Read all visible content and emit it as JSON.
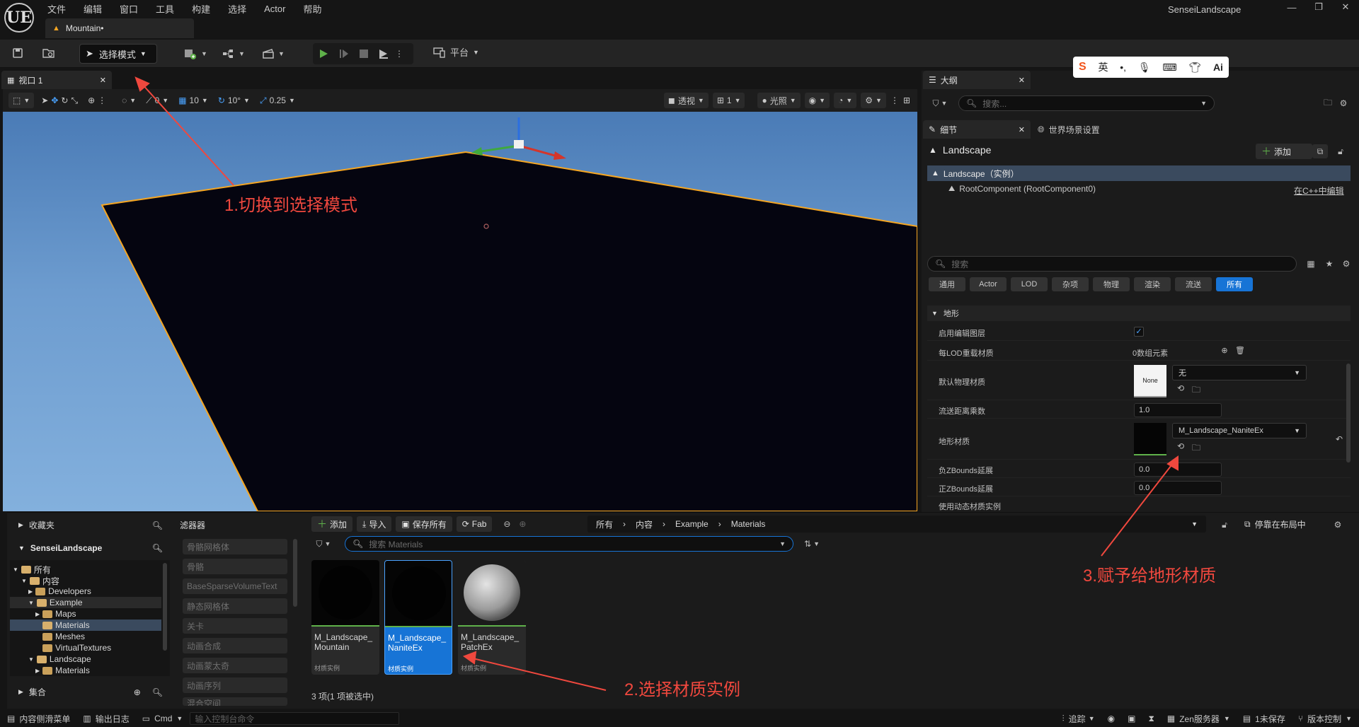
{
  "app": {
    "name": "SenseiLandscape",
    "logo": "UE",
    "document_tab": "Mountain•"
  },
  "menu": [
    "文件",
    "编辑",
    "窗口",
    "工具",
    "构建",
    "选择",
    "Actor",
    "帮助"
  ],
  "toolbar": {
    "mode_button": "选择模式",
    "platforms": "平台"
  },
  "viewport": {
    "tab": "视口 1",
    "toolbar": {
      "rotation_snap": "0",
      "grid_snap": "10",
      "angle_snap": "10°",
      "scale_snap": "0.25",
      "view_mode": "透视",
      "camera_speed": "1",
      "lighting": "光照"
    }
  },
  "outliner": {
    "tab": "大纲",
    "search_placeholder": "搜索..."
  },
  "details": {
    "tab": "细节",
    "world_settings_tab": "世界场景设置",
    "actor_name": "Landscape",
    "add_button": "添加",
    "instance_row": "Landscape（实例）",
    "root_component": "RootComponent (RootComponent0)",
    "edit_in_cpp": "在C++中编辑",
    "search_placeholder": "搜索",
    "categories": [
      "通用",
      "Actor",
      "LOD",
      "杂项",
      "物理",
      "渲染",
      "流送",
      "所有"
    ],
    "section": "地形",
    "properties": {
      "enable_edit_layers": "启用编辑图层",
      "per_lod_override": "每LOD重载材质",
      "per_lod_override_value": "0数组元素",
      "default_phys_material": "默认物理材质",
      "phys_thumb": "None",
      "phys_value": "无",
      "stream_distance": "流送距离乘数",
      "stream_distance_value": "1.0",
      "landscape_material": "地形材质",
      "landscape_material_value": "M_Landscape_NaniteEx",
      "neg_z_bounds": "负ZBounds延展",
      "neg_z_bounds_value": "0.0",
      "pos_z_bounds": "正ZBounds延展",
      "pos_z_bounds_value": "0.0",
      "dynamic_material": "使用动态材质实例"
    }
  },
  "content_browser": {
    "favorites": "收藏夹",
    "project": "SenseiLandscape",
    "tree": [
      "所有",
      "内容",
      "Developers",
      "Example",
      "Maps",
      "Materials",
      "Meshes",
      "VirtualTextures",
      "Landscape",
      "Materials"
    ],
    "collections": "集合",
    "filters_title": "滤器器",
    "filters": [
      "骨骼网格体",
      "骨骼",
      "BaseSparseVolumeText",
      "静态网格体",
      "关卡",
      "动画合成",
      "动画蒙太奇",
      "动画序列",
      "混合空间"
    ],
    "buttons": {
      "add": "添加",
      "import": "导入",
      "save_all": "保存所有",
      "fab": "Fab"
    },
    "path": [
      "所有",
      "内容",
      "Example",
      "Materials"
    ],
    "dock": "停靠在布局中",
    "search_placeholder": "搜索 Materials",
    "assets": [
      {
        "name": "M_Landscape_Mountain",
        "type": "材质实例"
      },
      {
        "name": "M_Landscape_NaniteEx",
        "type": "材质实例"
      },
      {
        "name": "M_Landscape_PatchEx",
        "type": "材质实例"
      }
    ],
    "status": "3 项(1 项被选中)"
  },
  "statusbar": {
    "drawer": "内容侧滑菜单",
    "output_log": "输出日志",
    "cmd": "Cmd",
    "console_placeholder": "输入控制台命令",
    "trace": "追踪",
    "zen": "Zen服务器",
    "unsaved": "1未保存",
    "source_control": "版本控制"
  },
  "ime": {
    "lang": "英"
  },
  "annotations": {
    "step1": "1.切换到选择模式",
    "step2": "2.选择材质实例",
    "step3": "3.赋予给地形材质"
  },
  "colors": {
    "accent": "#1774d6",
    "annotation": "#f0483e",
    "selection_outline": "#f5a623",
    "sky": "#6d9ccf"
  }
}
